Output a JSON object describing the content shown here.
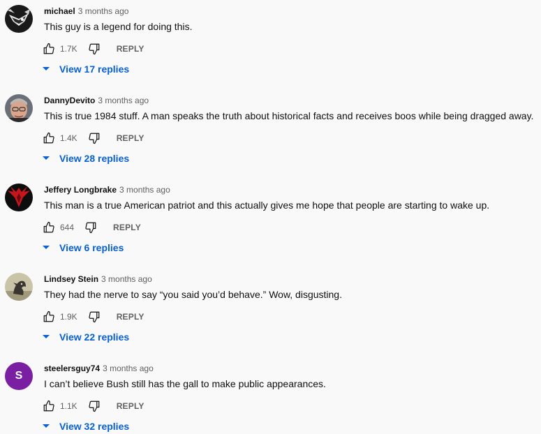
{
  "colors": {
    "link_blue": "#065fd4",
    "muted_text": "#606060",
    "primary_text": "#0f0f0f",
    "background": "#f9f9f9",
    "letter_avatar_bg": "#7b1fa2"
  },
  "icons": {
    "like": "thumbs-up-icon",
    "dislike": "thumbs-down-icon",
    "expand": "caret-down-icon"
  },
  "comments": [
    {
      "author": "michael",
      "time": "3 months ago",
      "text": "This guy is a legend for doing this.",
      "likes": "1.7K",
      "reply_label": "REPLY",
      "view_replies": "View 17 replies"
    },
    {
      "author": "DannyDevito",
      "time": "3 months ago",
      "text": "This is true 1984 stuff. A man speaks the truth about historical facts and receives boos while being dragged away.",
      "likes": "1.4K",
      "reply_label": "REPLY",
      "view_replies": "View 28 replies"
    },
    {
      "author": "Jeffery Longbrake",
      "time": "3 months ago",
      "text": "This man is a true American patriot and this actually gives me hope that people are starting to wake up.",
      "likes": "644",
      "reply_label": "REPLY",
      "view_replies": "View 6 replies"
    },
    {
      "author": "Lindsey Stein",
      "time": "3 months ago",
      "text": "They had the nerve to say “you said you’d behave.” Wow, disgusting.",
      "likes": "1.9K",
      "reply_label": "REPLY",
      "view_replies": "View 22 replies"
    },
    {
      "author": "steelersguy74",
      "time": "3 months ago",
      "text": "I can’t believe Bush still has the gall to make public appearances.",
      "likes": "1.1K",
      "reply_label": "REPLY",
      "view_replies": "View 32 replies",
      "avatar_letter": "S"
    }
  ]
}
